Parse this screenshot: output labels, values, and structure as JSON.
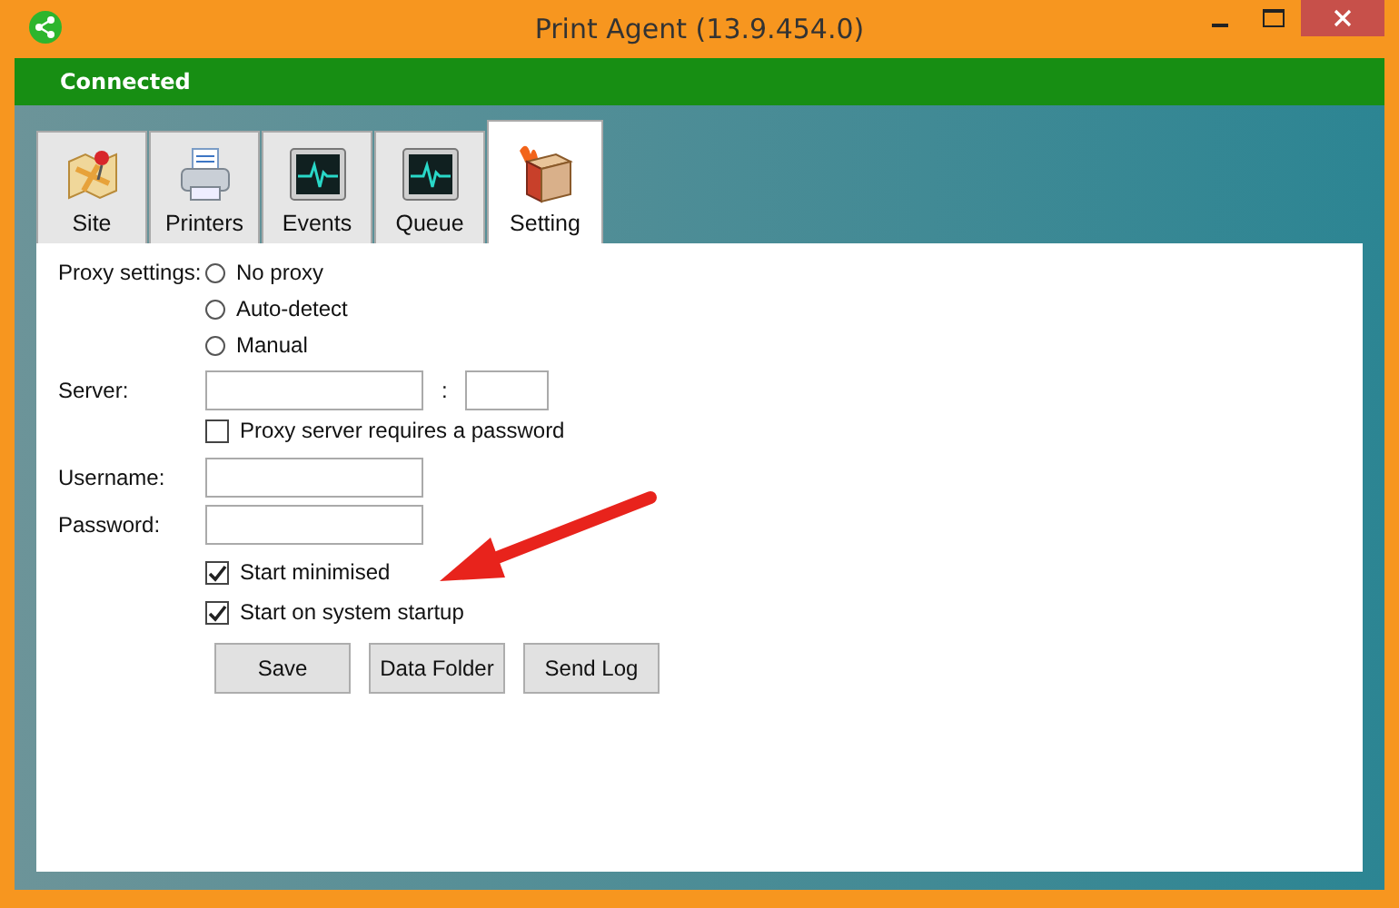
{
  "window": {
    "title": "Print Agent (13.9.454.0)"
  },
  "status": {
    "text": "Connected"
  },
  "tabs": [
    {
      "label": "Site",
      "kind": "map",
      "selected": false
    },
    {
      "label": "Printers",
      "kind": "printer",
      "selected": false
    },
    {
      "label": "Events",
      "kind": "monitor",
      "selected": false
    },
    {
      "label": "Queue",
      "kind": "monitor",
      "selected": false
    },
    {
      "label": "Setting",
      "kind": "box",
      "selected": true
    }
  ],
  "proxy": {
    "label": "Proxy settings:",
    "options": [
      {
        "label": "No proxy",
        "selected": false
      },
      {
        "label": "Auto-detect",
        "selected": false
      },
      {
        "label": "Manual",
        "selected": false
      }
    ]
  },
  "server": {
    "label": "Server:",
    "separator": ":"
  },
  "requires_password": {
    "label": "Proxy server requires a password",
    "checked": false
  },
  "username": {
    "label": "Username:"
  },
  "password": {
    "label": "Password:"
  },
  "startup_options": [
    {
      "label": "Start minimised",
      "checked": true
    },
    {
      "label": "Start on system startup",
      "checked": true
    }
  ],
  "buttons": [
    "Save",
    "Data Folder",
    "Send Log"
  ]
}
